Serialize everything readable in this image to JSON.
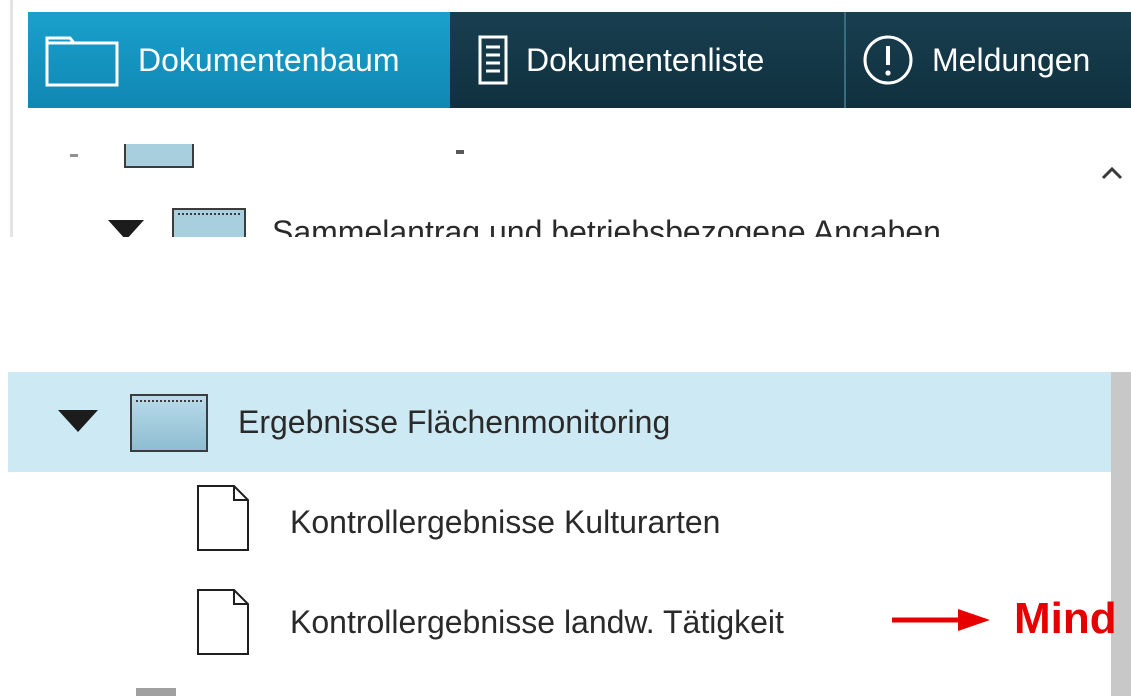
{
  "tabs": {
    "tree_label": "Dokumentenbaum",
    "list_label": "Dokumentenliste",
    "messages_label": "Meldungen"
  },
  "tree": {
    "partial_row_label": "Sammelantrag und betriebsbezogene Angaben",
    "folder_label": "Ergebnisse Flächenmonitoring",
    "doc1_label": "Kontrollergebnisse Kulturarten",
    "doc2_label": "Kontrollergebnisse landw. Tätigkeit"
  },
  "annotation": {
    "text": "Mind",
    "color": "#e60000"
  },
  "colors": {
    "active_tab": "#1a9fcb",
    "inactive_tab": "#15394a",
    "selected_row": "#cde9f3"
  },
  "icons": {
    "tab_tree": "folder-outline-icon",
    "tab_list": "document-list-icon",
    "tab_messages": "exclamation-circle-icon",
    "row_expander": "triangle-down-icon",
    "folder": "folder-icon",
    "document": "document-icon",
    "scroll": "chevron-up-icon",
    "annotation": "arrow-right-icon"
  }
}
